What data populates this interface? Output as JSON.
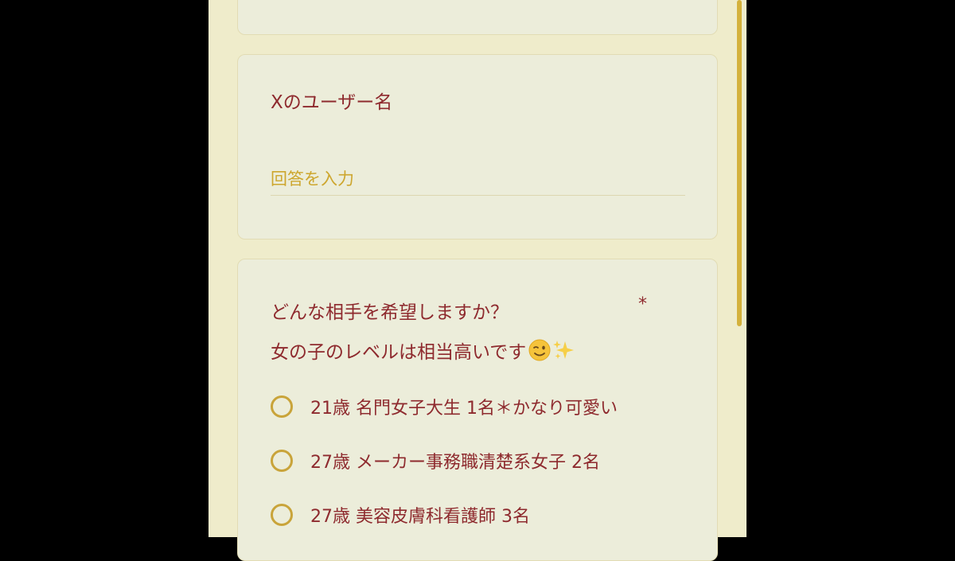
{
  "form": {
    "username_question": {
      "title": "Xのユーザー名",
      "placeholder": "回答を入力"
    },
    "preference_question": {
      "title_line1": "どんな相手を希望しますか？",
      "title_line2": "女の子のレベルは相当高いです",
      "required_mark": "*",
      "title_emojis": [
        "winking-face-icon",
        "sparkles-icon"
      ],
      "options": [
        {
          "label": "21歳 名門女子大生 1名＊かなり可愛い"
        },
        {
          "label": "27歳 メーカー事務職清楚系女子 2名"
        },
        {
          "label": "27歳 美容皮膚科看護師 3名"
        }
      ]
    }
  },
  "colors": {
    "background": "#efeccb",
    "card": "#ecedda",
    "text": "#8e2a2e",
    "accent": "#cda62e",
    "letterbox": "#000000"
  }
}
